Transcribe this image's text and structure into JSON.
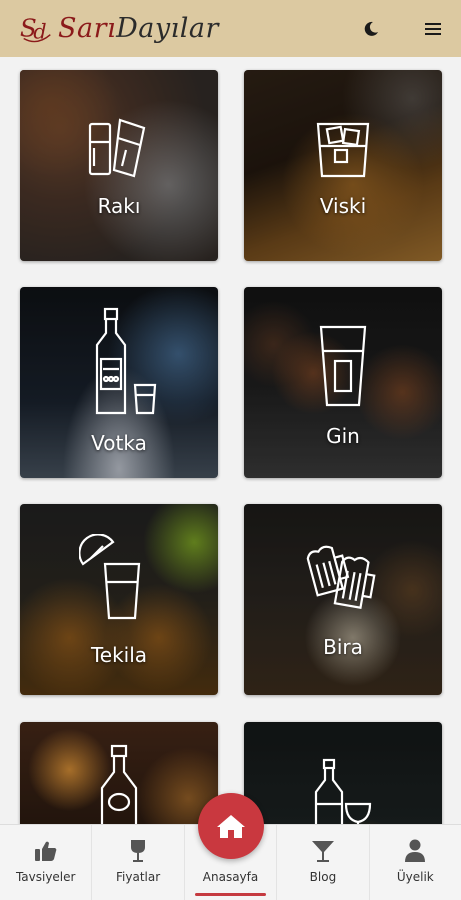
{
  "header": {
    "brand_first": "Sarı",
    "brand_second": "Dayılar",
    "theme_icon": "moon-icon",
    "menu_icon": "hamburger-menu-icon"
  },
  "categories": [
    {
      "label": "Rakı",
      "icon": "raki-glasses-icon"
    },
    {
      "label": "Viski",
      "icon": "whisky-glass-icon"
    },
    {
      "label": "Votka",
      "icon": "vodka-bottle-icon"
    },
    {
      "label": "Gin",
      "icon": "gin-shot-icon"
    },
    {
      "label": "Tekila",
      "icon": "tequila-lime-icon"
    },
    {
      "label": "Bira",
      "icon": "beer-mugs-icon"
    },
    {
      "label": "",
      "icon": "liqueur-bottle-icon"
    },
    {
      "label": "",
      "icon": "wine-bottle-glass-icon"
    }
  ],
  "nav": {
    "items": [
      {
        "label": "Tavsiyeler",
        "icon": "thumbs-up-icon"
      },
      {
        "label": "Fiyatlar",
        "icon": "wine-glass-icon"
      },
      {
        "label": "Anasayfa",
        "icon": "home-icon"
      },
      {
        "label": "Blog",
        "icon": "cocktail-glass-icon"
      },
      {
        "label": "Üyelik",
        "icon": "user-icon"
      }
    ],
    "active_index": 2
  },
  "colors": {
    "header_bg": "#dcc9a1",
    "accent": "#c9383f",
    "brand_red": "#8b1a1a"
  }
}
